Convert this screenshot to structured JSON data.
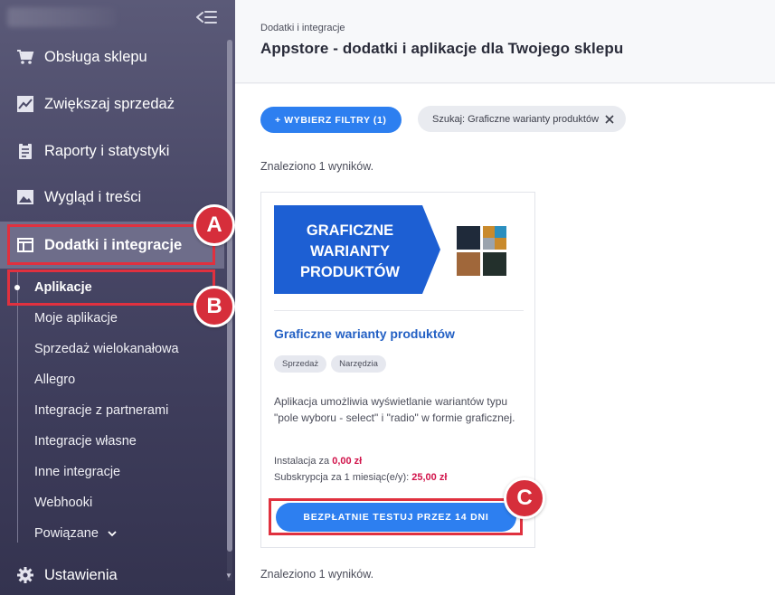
{
  "sidebar": {
    "items": [
      {
        "label": "Obsługa sklepu",
        "icon": "cart-icon"
      },
      {
        "label": "Zwiększaj sprzedaż",
        "icon": "chart-icon"
      },
      {
        "label": "Raporty i statystyki",
        "icon": "clipboard-icon"
      },
      {
        "label": "Wygląd i treści",
        "icon": "image-icon"
      },
      {
        "label": "Dodatki i integracje",
        "icon": "window-icon",
        "active": true
      },
      {
        "label": "Ustawienia",
        "icon": "gear-icon"
      }
    ],
    "subitems": [
      {
        "label": "Aplikacje",
        "active": true
      },
      {
        "label": "Moje aplikacje"
      },
      {
        "label": "Sprzedaż wielokanałowa"
      },
      {
        "label": "Allegro"
      },
      {
        "label": "Integracje z partnerami"
      },
      {
        "label": "Integracje własne"
      },
      {
        "label": "Inne integracje"
      },
      {
        "label": "Webhooki"
      },
      {
        "label": "Powiązane"
      }
    ]
  },
  "header": {
    "breadcrumb": "Dodatki i integracje",
    "title": "Appstore - dodatki i aplikacje dla Twojego sklepu"
  },
  "toolbar": {
    "filter_label": "+ WYBIERZ FILTRY (1)",
    "search_chip": "Szukaj: Graficzne warianty produktów"
  },
  "results_text": "Znaleziono 1 wyników.",
  "card": {
    "banner_lines": [
      "GRAFICZNE",
      "WARIANTY",
      "PRODUKTÓW"
    ],
    "title": "Graficzne warianty produktów",
    "tags": [
      "Sprzedaż",
      "Narzędzia"
    ],
    "description": "Aplikacja umożliwia wyświetlanie wariantów typu \"pole wyboru - select\" i \"radio\" w formie graficznej.",
    "install_prefix": "Instalacja za",
    "install_price": "0,00 zł",
    "sub_prefix": "Subskrypcja za 1 miesiąc(e/y):",
    "sub_price": "25,00 zł",
    "cta": "BEZPŁATNIE TESTUJ PRZEZ 14 DNI"
  },
  "annotations": {
    "a": "A",
    "b": "B",
    "c": "C"
  },
  "colors": {
    "accent": "#2d7ff0",
    "highlight": "#e0313f",
    "price": "#d1134a"
  }
}
